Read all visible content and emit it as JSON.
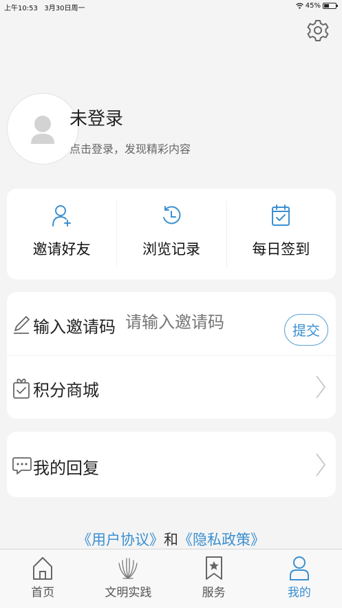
{
  "status_bar": {
    "time": "上午10:53",
    "date": "3月30日周一",
    "battery_text": "45%",
    "battery_level": 0.45
  },
  "profile": {
    "title": "未登录",
    "subtitle": "点击登录，发现精彩内容"
  },
  "quick_actions": [
    {
      "label": "邀请好友",
      "icon": "invite-user-icon"
    },
    {
      "label": "浏览记录",
      "icon": "history-clock-icon"
    },
    {
      "label": "每日签到",
      "icon": "calendar-check-icon"
    }
  ],
  "invite": {
    "label": "输入邀请码",
    "placeholder": "请输入邀请码",
    "submit": "提交"
  },
  "menu": {
    "points_mall": "积分商城",
    "my_replies": "我的回复"
  },
  "agreement": {
    "user_agreement": "《用户协议》",
    "and": "和",
    "privacy_policy": "《隐私政策》"
  },
  "tabs": [
    {
      "label": "首页",
      "icon": "home-icon"
    },
    {
      "label": "文明实践",
      "icon": "practice-logo-icon"
    },
    {
      "label": "服务",
      "icon": "bookmark-star-icon"
    },
    {
      "label": "我的",
      "icon": "user-icon",
      "active": true
    }
  ],
  "colors": {
    "accent": "#3a8fd0",
    "background": "#f4f4f4",
    "card": "#ffffff"
  }
}
